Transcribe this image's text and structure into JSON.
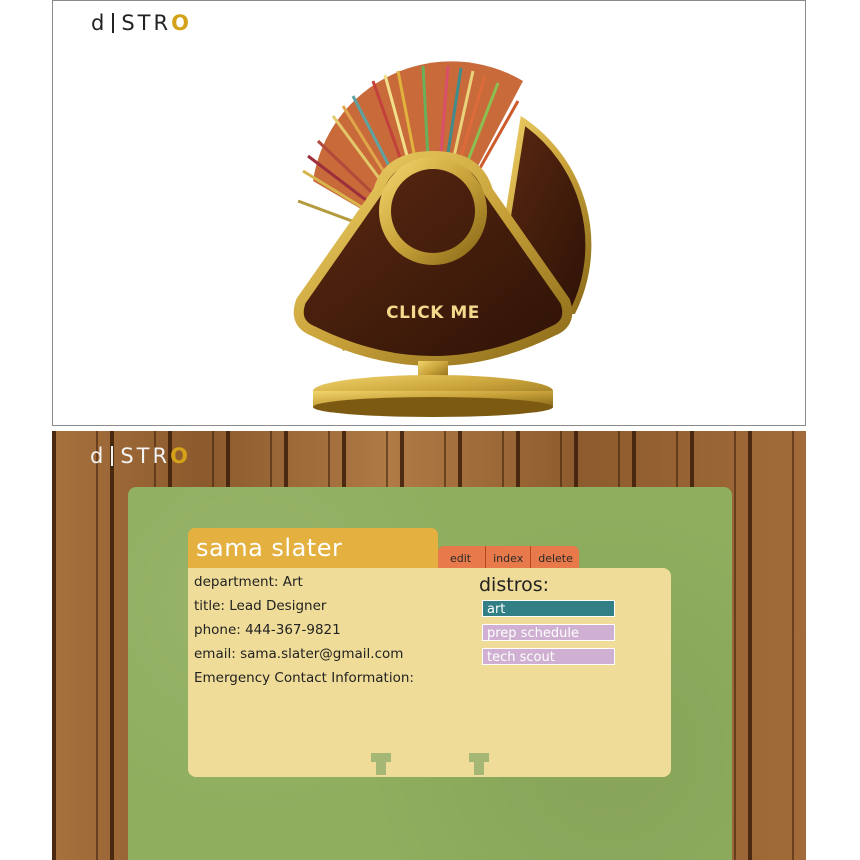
{
  "app": {
    "logo_text_a": "d",
    "logo_text_b": "STR",
    "logo_text_o": "O"
  },
  "top": {
    "click_me": "CLICK ME"
  },
  "card": {
    "name": "sama slater",
    "actions": [
      "edit",
      "index",
      "delete"
    ],
    "fields": [
      "department: Art",
      "title: Lead Designer",
      "phone: 444-367-9821",
      "email: sama.slater@gmail.com",
      "Emergency Contact Information:"
    ],
    "distros_title": "distros:",
    "distros": [
      "art",
      "prep schedule",
      "tech scout"
    ]
  },
  "colors": {
    "accent_gold": "#e4b040",
    "tab_orange": "#e7794a",
    "card_cream": "#efdc98",
    "distro_teal": "#327f86",
    "distro_lavender": "#cfb0d2",
    "board_green": "#8fae5e"
  }
}
